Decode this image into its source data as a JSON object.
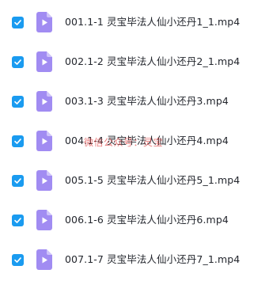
{
  "colors": {
    "checkbox": "#1a9bf0",
    "video_icon": "#a18cf2",
    "video_icon_fold": "#cfc4fa",
    "text": "#24272e",
    "watermark": "#e24e4e"
  },
  "files": [
    {
      "name": "001.1-1 灵宝毕法人仙小还丹1_1.mp4",
      "checked": true,
      "icon": "video-file-icon"
    },
    {
      "name": "002.1-2 灵宝毕法人仙小还丹2_1.mp4",
      "checked": true,
      "icon": "video-file-icon"
    },
    {
      "name": "003.1-3 灵宝毕法人仙小还丹3.mp4",
      "checked": true,
      "icon": "video-file-icon"
    },
    {
      "name": "004.1-4 灵宝毕法人仙小还丹4.mp4",
      "checked": true,
      "icon": "video-file-icon"
    },
    {
      "name": "005.1-5 灵宝毕法人仙小还丹5_1.mp4",
      "checked": true,
      "icon": "video-file-icon"
    },
    {
      "name": "006.1-6 灵宝毕法人仙小还丹6.mp4",
      "checked": true,
      "icon": "video-file-icon"
    },
    {
      "name": "007.1-7 灵宝毕法人仙小还丹7_1.mp4",
      "checked": true,
      "icon": "video-file-icon"
    }
  ],
  "watermark": "微信公众号：灵宝"
}
